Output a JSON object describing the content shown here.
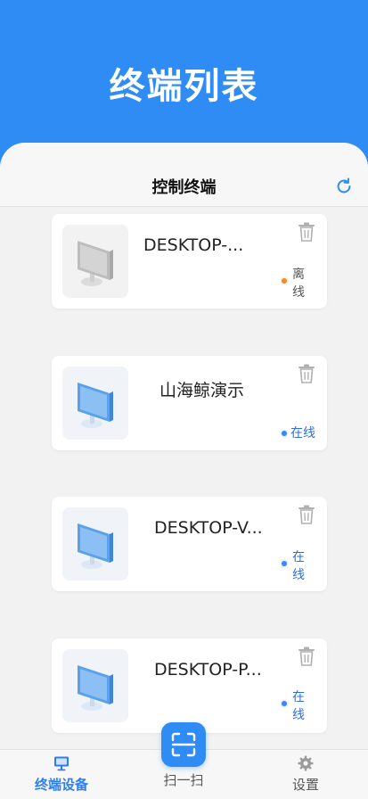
{
  "header": {
    "title": "终端列表"
  },
  "panel": {
    "title": "控制终端"
  },
  "devices": [
    {
      "name": "DESKTOP-...",
      "status": "离线",
      "online": false
    },
    {
      "name": "山海鲸演示",
      "status": "在线",
      "online": true
    },
    {
      "name": "DESKTOP-V...",
      "status": "在线",
      "online": true
    },
    {
      "name": "DESKTOP-P...",
      "status": "在线",
      "online": true
    }
  ],
  "tabbar": {
    "devices_label": "终端设备",
    "scan_label": "扫一扫",
    "settings_label": "设置"
  },
  "colors": {
    "primary": "#2f8cf4",
    "online": "#3a86ff",
    "offline": "#f28c2a"
  },
  "icons": [
    "refresh-icon",
    "trash-icon",
    "monitor-icon",
    "scan-icon",
    "gear-icon"
  ]
}
